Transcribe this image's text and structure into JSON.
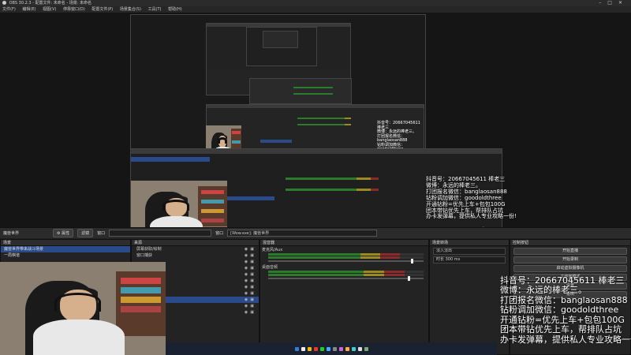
{
  "window": {
    "title": "OBS 30.2.3 - 配置文件: 未命名 - 场景: 未命名"
  },
  "menu": [
    "文件(F)",
    "编辑(E)",
    "视图(V)",
    "停靠窗口(D)",
    "配置文件(P)",
    "场景集合(S)",
    "工具(T)",
    "帮助(H)"
  ],
  "overlay": {
    "lines": [
      "抖音号：20667045611  棒老三",
      "微博：永远的棒老三。",
      "打团报名微信：banglaosan888",
      "钻粉调加微信：goodoldthree",
      "开通钻粉=优先上车+包包100G",
      "团本带钻优先上车，帮排队占坑",
      "办卡发弹幕，提供私人专业攻略一份!"
    ]
  },
  "scenebar": {
    "scene": "魔兽世界",
    "properties": "⚙ 属性",
    "filters": "滤镜",
    "window_label": "窗口",
    "window_value": "[Wow.exe]: 魔兽世界"
  },
  "docks": {
    "scenes": {
      "title": "场景",
      "items": [
        "魔兽世界带来战斗场景",
        "一局棋谱"
      ]
    },
    "sources": {
      "title": "来源",
      "items": [
        "屏幕获取/绘制",
        "窗口捕获",
        "",
        "",
        "",
        "",
        "",
        "",
        "",
        ""
      ]
    },
    "mixer": {
      "title": "混音器",
      "channels": [
        {
          "label": "麦克风/Aux",
          "level": 0.85,
          "volume": 0.92
        },
        {
          "label": "桌面音频",
          "level": 0.88,
          "volume": 0.9
        }
      ]
    },
    "transitions": {
      "title": "场景转场",
      "type": "淡入淡出",
      "duration_label": "时长",
      "duration": "300 ms"
    },
    "controls": {
      "title": "控制按钮",
      "buttons": [
        "开始直播",
        "开始录制",
        "启动虚拟摄像机",
        "工作室模式",
        "设置",
        "退出"
      ]
    }
  },
  "colors": {
    "accent": "#2b4a8a",
    "meter_green": "#2c7a2c",
    "meter_yellow": "#9a8a1f",
    "meter_red": "#8b2a2a"
  }
}
